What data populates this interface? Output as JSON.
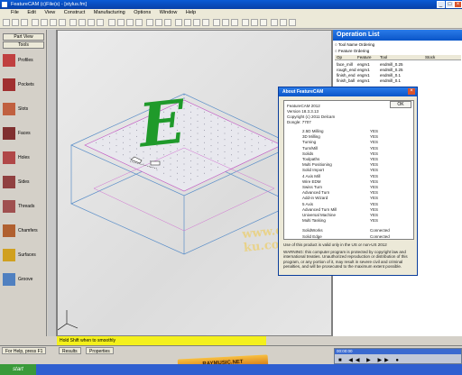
{
  "window": {
    "title": "FeatureCAM (c)File(s) - [stylus.fm]"
  },
  "menu": [
    "File",
    "Edit",
    "View",
    "Construct",
    "Manufacturing",
    "Options",
    "Window",
    "Help"
  ],
  "left_panel": {
    "buttons": [
      "Part View",
      "Tools"
    ],
    "items": [
      {
        "label": "Profiles",
        "icon": "profile-icon"
      },
      {
        "label": "Pockets",
        "icon": "pocket-icon"
      },
      {
        "label": "Slots",
        "icon": "slot-icon"
      },
      {
        "label": "Faces",
        "icon": "face-icon"
      },
      {
        "label": "Holes",
        "icon": "hole-icon"
      },
      {
        "label": "Sides",
        "icon": "side-icon"
      },
      {
        "label": "Threads",
        "icon": "thread-icon"
      },
      {
        "label": "Chamfers",
        "icon": "chamfer-icon"
      },
      {
        "label": "Surfaces",
        "icon": "surface-icon"
      },
      {
        "label": "Groove",
        "icon": "groove-icon"
      }
    ]
  },
  "viewport": {
    "engraving_letter": "E",
    "watermark": "www.cg-ku.com"
  },
  "status": {
    "message": "Hold Shift when to smoothly",
    "help": "For Help, press F1"
  },
  "bottom_tabs": [
    "Results",
    "Properties"
  ],
  "operation_list": {
    "title": "Operation List",
    "options": [
      "Tool Name Ordering",
      "Feature Ordering"
    ],
    "columns": [
      "Op",
      "Feature",
      "Tool",
      "Stock"
    ],
    "rows": [
      {
        "op": "face_mill",
        "feature": "engrv1",
        "tool": "endmill_0.25"
      },
      {
        "op": "rough_end",
        "feature": "engrv1",
        "tool": "endmill_0.25"
      },
      {
        "op": "finish_end",
        "feature": "engrv1",
        "tool": "endmill_0.1"
      },
      {
        "op": "finish_ball",
        "feature": "engrv1",
        "tool": "endmill_0.1"
      }
    ]
  },
  "about_dialog": {
    "title": "About FeatureCAM",
    "ok_label": "OK",
    "product": "FeatureCAM 2012",
    "version": "Version 18.3.3.13",
    "copyright": "Copyright (c) 2011 Delcam",
    "dongle": "Dongle: 7707",
    "licenses": [
      {
        "name": "2.5D Milling",
        "value": "YES"
      },
      {
        "name": "3D Milling",
        "value": "YES"
      },
      {
        "name": "Turning",
        "value": "YES"
      },
      {
        "name": "Turn/Mill",
        "value": "YES"
      },
      {
        "name": "Solids",
        "value": "YES"
      },
      {
        "name": "Toolpaths",
        "value": "YES"
      },
      {
        "name": "Multi Positioning",
        "value": "YES"
      },
      {
        "name": "Solid Import",
        "value": "YES"
      },
      {
        "name": "4 Axis Mill",
        "value": "YES"
      },
      {
        "name": "Wire EDM",
        "value": "YES"
      },
      {
        "name": "Swiss Turn",
        "value": "YES"
      },
      {
        "name": "Advanced Turn",
        "value": "YES"
      },
      {
        "name": "Add-in Wizard",
        "value": "YES"
      },
      {
        "name": "5 Axis",
        "value": "YES"
      },
      {
        "name": "Advanced Turn Mill",
        "value": "YES"
      },
      {
        "name": "Universal Machine",
        "value": "YES"
      },
      {
        "name": "Multi Tasking",
        "value": "YES"
      }
    ],
    "extras": [
      {
        "name": "SolidWorks",
        "value": "Connected"
      },
      {
        "name": "Solid Edge",
        "value": "Connected"
      }
    ],
    "footer": [
      "Use of this product is valid only in the US or non-US 2012",
      "WARNING: this computer program is protected by copyright law and",
      "international treaties. Unauthorized reproduction or distribution of this",
      "program, or any portion of it, may result in severe civil and criminal",
      "penalties, and will be prosecuted to the maximum extent possible."
    ]
  },
  "media_player": {
    "title": "00:00:00"
  },
  "logo": {
    "text": "RAYMUSIC.NET"
  },
  "colors": {
    "engraving": "#1f9a2a",
    "status_bar": "#f4f01c",
    "title_bar": "#0a55c8"
  }
}
